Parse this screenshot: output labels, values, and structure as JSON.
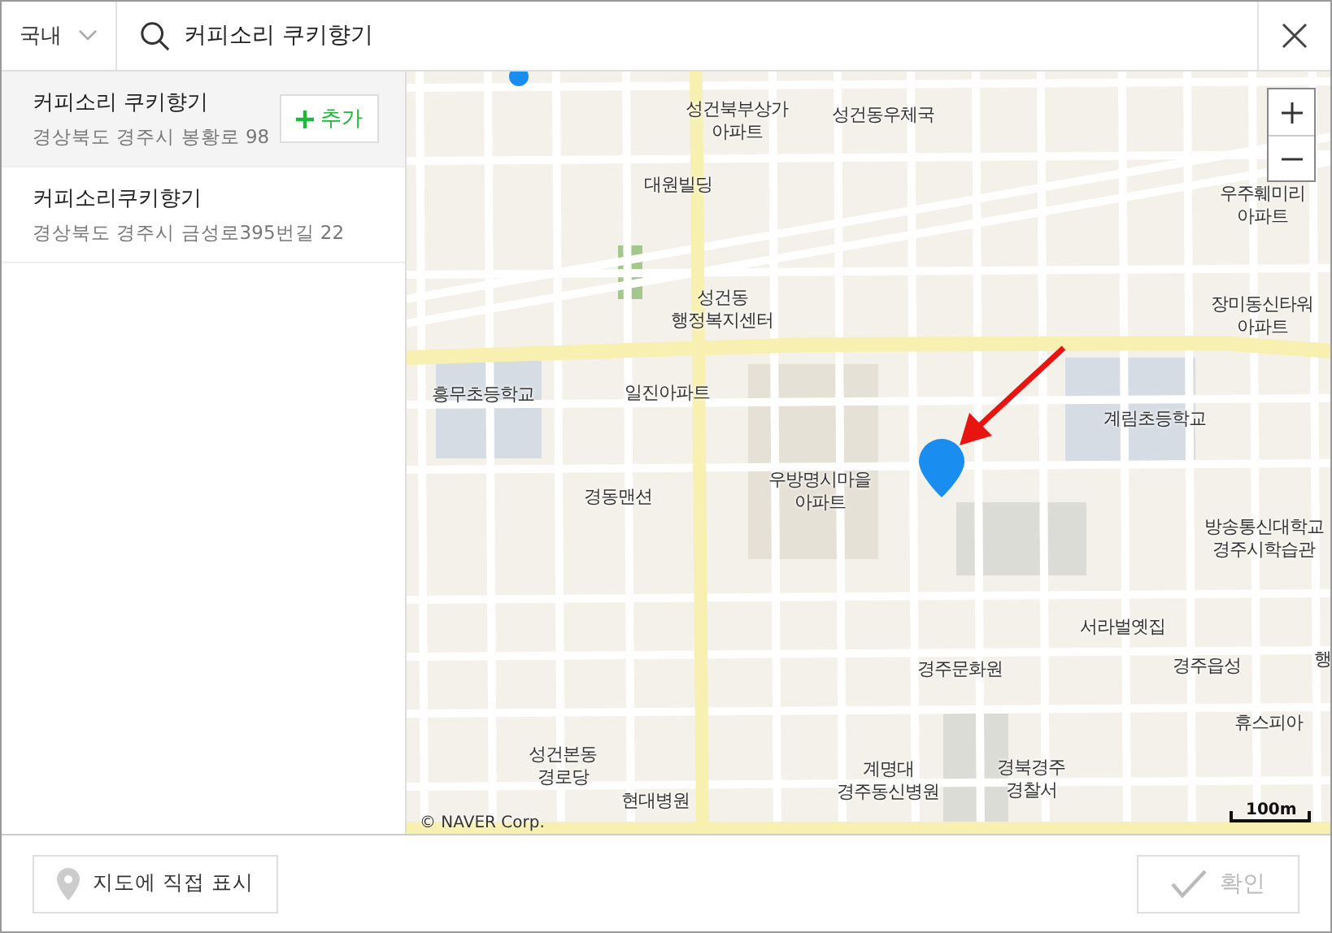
{
  "region_select": {
    "value": "국내"
  },
  "search": {
    "value": "커피소리 쿠키향기"
  },
  "results": {
    "add_label": "추가",
    "items": [
      {
        "name": "커피소리 쿠키향기",
        "address": "경상북도 경주시 봉황로 98",
        "selected": true
      },
      {
        "name": "커피소리쿠키향기",
        "address": "경상북도 경주시 금성로395번길 22",
        "selected": false
      }
    ]
  },
  "map": {
    "labels": [
      "성건북부상가\n아파트",
      "성건동우체국",
      "대원빌딩",
      "우주훼미리\n아파트",
      "성건동\n행정복지센터",
      "장미동신타워\n아파트",
      "흥무초등학교",
      "일진아파트",
      "계림초등학교",
      "경동맨션",
      "우방명시마을\n아파트",
      "방송통신대학교\n경주시학습관",
      "서라벌옛집",
      "경주문화원",
      "경주읍성",
      "행",
      "휴스피아",
      "성건본동\n경로당",
      "현대병원",
      "계명대\n경주동신병원",
      "경북경주\n경찰서"
    ],
    "copyright": "© NAVER Corp.",
    "scale": "100m"
  },
  "footer": {
    "place_button": "지도에 직접 표시",
    "confirm": {
      "label": "확인",
      "disabled": true
    }
  }
}
